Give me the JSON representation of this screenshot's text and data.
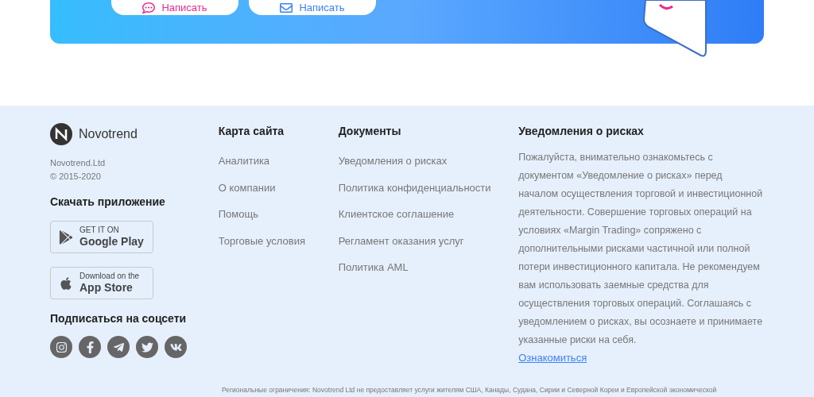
{
  "banner": {
    "buttons": [
      {
        "label": "Написать",
        "kind": "chat"
      },
      {
        "label": "Написать",
        "kind": "mail"
      }
    ]
  },
  "footer": {
    "brand": {
      "name": "Novotrend",
      "company": "Novotrend.Ltd",
      "copyright": "© 2015-2020"
    },
    "apps": {
      "title": "Скачать приложение",
      "stores": [
        {
          "kind": "google",
          "small": "GET IT ON",
          "big": "Google Play"
        },
        {
          "kind": "apple",
          "small": "Download on the",
          "big": "App Store"
        }
      ]
    },
    "social": {
      "title": "Подписаться на соцсети",
      "networks": [
        {
          "kind": "instagram"
        },
        {
          "kind": "facebook"
        },
        {
          "kind": "telegram"
        },
        {
          "kind": "twitter"
        },
        {
          "kind": "vk"
        }
      ]
    },
    "sitemap": {
      "title": "Карта сайта",
      "links": [
        "Аналитика",
        "О компании",
        "Помощь",
        "Торговые условия"
      ]
    },
    "documents": {
      "title": "Документы",
      "links": [
        "Уведомления о рисках",
        "Политика конфиденциальности",
        "Клиентское соглашение",
        "Регламент оказания услуг",
        "Политика AML"
      ]
    },
    "risks": {
      "title": "Уведомления о рисках",
      "text": "Пожалуйста, внимательно ознакомьтесь с документом «Уведомление о рисках» перед началом осуществления торговой и инвестиционной деятельности. Совершение торговых операций на условиях «Margin Trading» сопряжено с дополнительными рисками частичной или полной потери инвестиционного капитала. Не рекомендуем вам использовать заемные средства для осуществления торговых операций. Соглашаясь с уведомлением о рисках, вы осознаете и принимаете указанные риски на себя.",
      "link": "Ознакомиться"
    },
    "disclaimer": "Региональные ограничения: Novotrend Ltd не предоставляет услуги жителям США, Канады, Судана, Сирии и Северной Кореи и Европейской экономической"
  }
}
